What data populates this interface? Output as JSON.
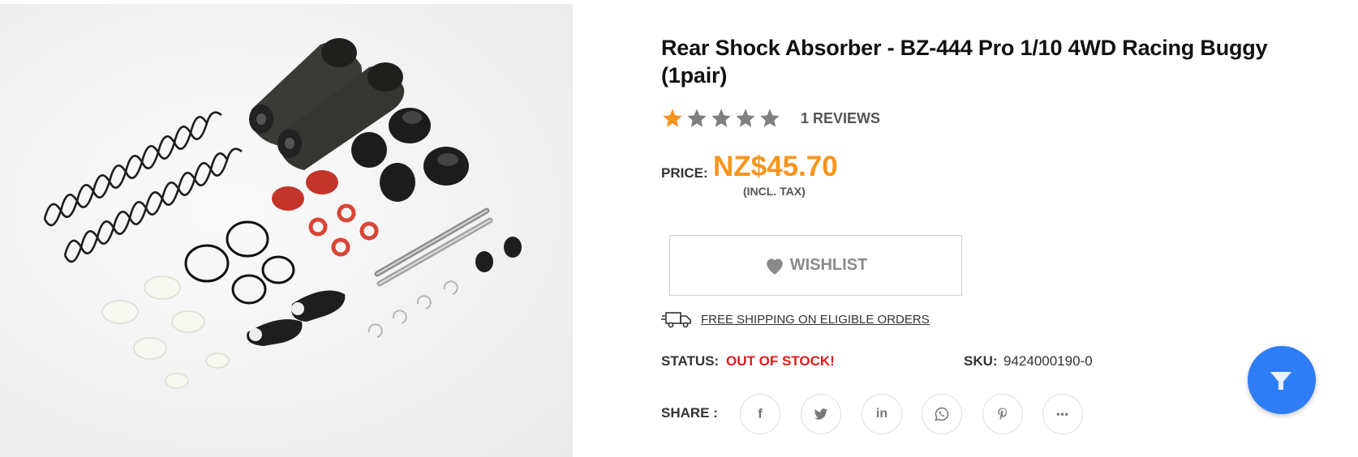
{
  "product": {
    "title": "Rear Shock Absorber - BZ-444 Pro 1/10 4WD Racing Buggy (1pair)",
    "image_icon": "shock-absorber-parts-photo"
  },
  "rating": {
    "filled_stars": 1,
    "total_stars": 5,
    "reviews_label": "1 REVIEWS",
    "star_filled_color": "#f7941d",
    "star_empty_color": "#808080"
  },
  "price": {
    "label": "PRICE:",
    "value": "NZ$45.70",
    "tax_note": "(INCL. TAX)",
    "color": "#f7941d"
  },
  "wishlist": {
    "label": "WISHLIST",
    "icon": "heart-icon"
  },
  "shipping": {
    "label": "FREE SHIPPING ON ELIGIBLE ORDERS",
    "icon": "truck-icon"
  },
  "status": {
    "label": "STATUS:",
    "value": "OUT OF STOCK!",
    "color": "#e11b1b"
  },
  "sku": {
    "label": "SKU:",
    "value": "9424000190-0"
  },
  "share": {
    "label": "SHARE :",
    "buttons": [
      {
        "name": "facebook",
        "glyph": "f",
        "icon": "facebook-icon"
      },
      {
        "name": "twitter",
        "icon": "twitter-icon"
      },
      {
        "name": "linkedin",
        "glyph": "in",
        "icon": "linkedin-icon"
      },
      {
        "name": "whatsapp",
        "icon": "whatsapp-icon"
      },
      {
        "name": "pinterest",
        "icon": "pinterest-icon"
      },
      {
        "name": "more",
        "glyph": "•••",
        "icon": "more-icon"
      }
    ]
  },
  "chat": {
    "icon": "chat-icon",
    "color": "#2f7df6"
  }
}
